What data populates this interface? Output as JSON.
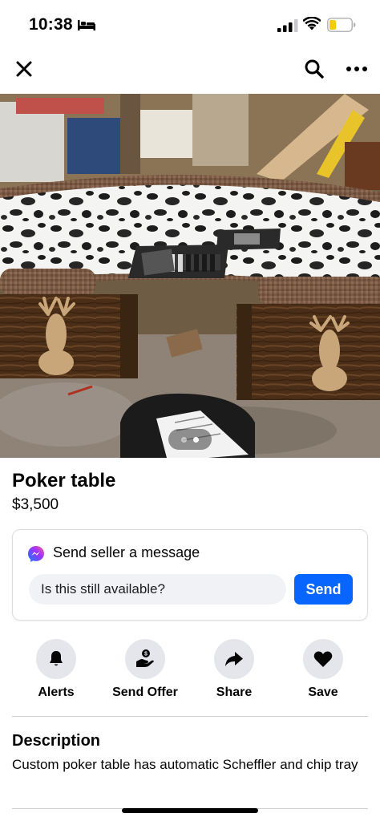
{
  "status_bar": {
    "time": "10:38",
    "icons": [
      "bed-icon",
      "signal-icon",
      "wifi-icon",
      "battery-icon"
    ]
  },
  "nav": {
    "icons": [
      "close-icon",
      "search-icon",
      "more-icon"
    ]
  },
  "photo": {
    "page_count": 2,
    "active_page": 2
  },
  "listing": {
    "title": "Poker table",
    "price": "$3,500"
  },
  "message": {
    "heading": "Send seller a message",
    "input_value": "Is this still available?",
    "send_label": "Send"
  },
  "actions": [
    {
      "label": "Alerts",
      "icon": "bell-icon"
    },
    {
      "label": "Send Offer",
      "icon": "offer-icon"
    },
    {
      "label": "Share",
      "icon": "share-icon"
    },
    {
      "label": "Save",
      "icon": "heart-icon"
    }
  ],
  "description": {
    "heading": "Description",
    "text": "Custom poker table has automatic Scheffler and chip tray"
  },
  "colors": {
    "accent": "#0866ff",
    "button_bg": "#e4e6eb",
    "input_bg": "#f0f2f5"
  }
}
